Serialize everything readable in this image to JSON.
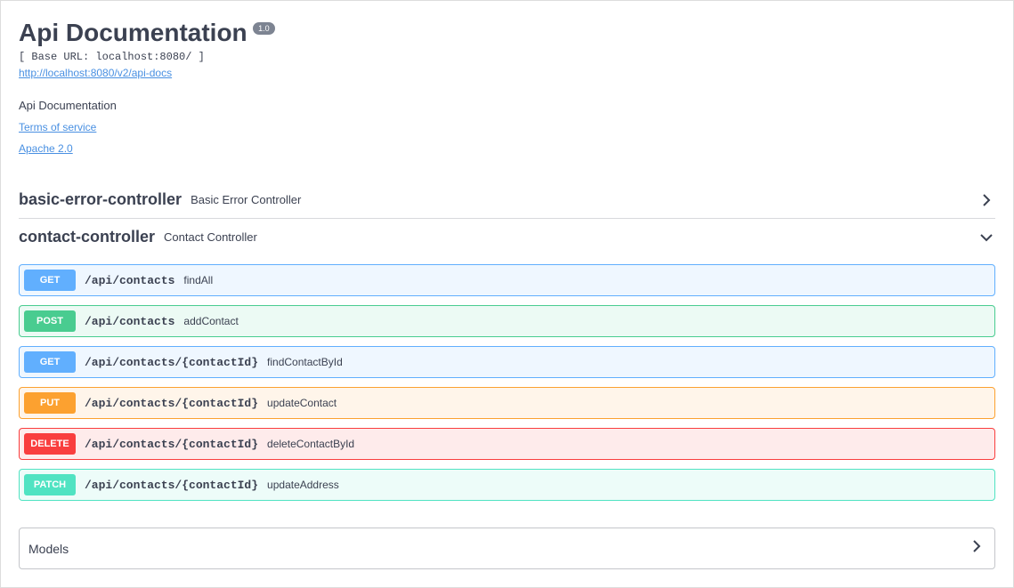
{
  "header": {
    "title": "Api Documentation",
    "version": "1.0",
    "base_url_label": "[ Base URL: localhost:8080/ ]",
    "api_docs_url": "http://localhost:8080/v2/api-docs"
  },
  "description": "Api Documentation",
  "links": {
    "terms": "Terms of service",
    "license": "Apache 2.0"
  },
  "tags": [
    {
      "name": "basic-error-controller",
      "desc": "Basic Error Controller",
      "expanded": false
    },
    {
      "name": "contact-controller",
      "desc": "Contact Controller",
      "expanded": true
    }
  ],
  "operations": [
    {
      "method": "GET",
      "path": "/api/contacts",
      "summary": "findAll",
      "css": "op-get"
    },
    {
      "method": "POST",
      "path": "/api/contacts",
      "summary": "addContact",
      "css": "op-post"
    },
    {
      "method": "GET",
      "path": "/api/contacts/{contactId}",
      "summary": "findContactById",
      "css": "op-get"
    },
    {
      "method": "PUT",
      "path": "/api/contacts/{contactId}",
      "summary": "updateContact",
      "css": "op-put"
    },
    {
      "method": "DELETE",
      "path": "/api/contacts/{contactId}",
      "summary": "deleteContactById",
      "css": "op-delete"
    },
    {
      "method": "PATCH",
      "path": "/api/contacts/{contactId}",
      "summary": "updateAddress",
      "css": "op-patch"
    }
  ],
  "models": {
    "title": "Models"
  }
}
